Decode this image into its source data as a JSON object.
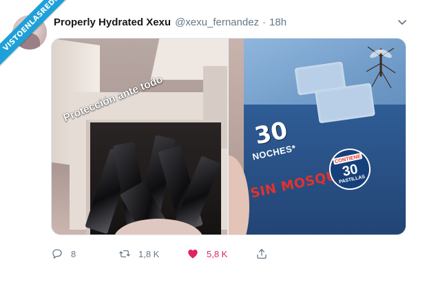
{
  "watermark": {
    "text": "VISTOENLASREDES"
  },
  "tweet": {
    "display_name": "Properly Hydrated Xexu",
    "handle": "@xexu_fernandez",
    "separator": "·",
    "time": "18h"
  },
  "media": {
    "left_photo": {
      "overlay_caption": "Protección ante todo"
    },
    "right_photo": {
      "package_number": "30",
      "package_line1": "NOCHES*",
      "package_line2": "SIN MOSQUITOS",
      "badge_top": "CONTIENE",
      "badge_number": "30",
      "badge_bottom": "PASTILLAS"
    }
  },
  "actions": {
    "reply": {
      "icon": "reply-icon",
      "count": "8"
    },
    "retweet": {
      "icon": "retweet-icon",
      "count": "1,8 K"
    },
    "like": {
      "icon": "heart-icon",
      "count": "5,8 K",
      "color": "#e0245e"
    },
    "share": {
      "icon": "share-icon"
    }
  },
  "colors": {
    "ribbon": "#1ea1d8",
    "text_primary": "#14171a",
    "text_secondary": "#657786",
    "like": "#e0245e"
  }
}
